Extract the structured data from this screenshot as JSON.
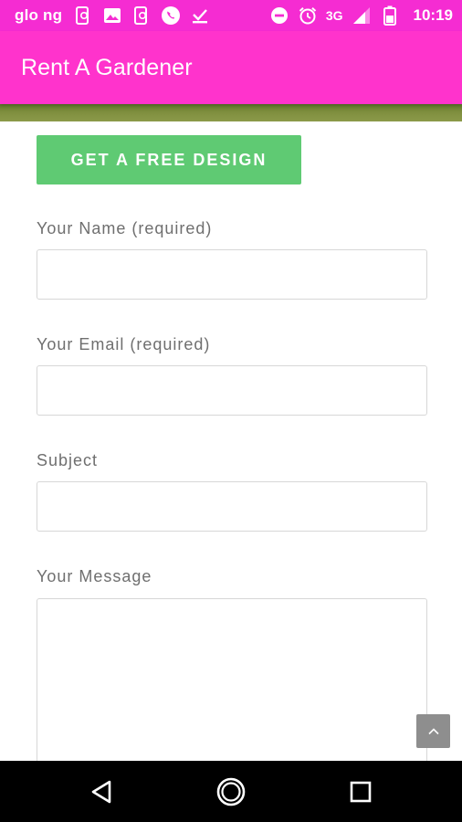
{
  "status_bar": {
    "carrier": "glo ng",
    "network_type": "3G",
    "time": "10:19",
    "icons_left": [
      "phone-sync-icon",
      "image-icon",
      "phone-sync-icon",
      "whatsapp-icon",
      "download-done-icon"
    ],
    "icons_right": [
      "do-not-disturb-icon",
      "alarm-icon",
      "signal-icon",
      "battery-icon"
    ]
  },
  "app_bar": {
    "title": "Rent A Gardener",
    "color": "#ff33cc"
  },
  "form": {
    "cta_label": "GET A FREE DESIGN",
    "cta_color": "#5fca73",
    "fields": [
      {
        "label": "Your Name (required)",
        "value": "",
        "placeholder": ""
      },
      {
        "label": "Your Email (required)",
        "value": "",
        "placeholder": ""
      },
      {
        "label": "Subject",
        "value": "",
        "placeholder": ""
      },
      {
        "label": "Your Message",
        "value": "",
        "placeholder": ""
      }
    ]
  },
  "scroll_top": {
    "icon": "chevron-up-icon"
  },
  "nav_bar": {
    "buttons": [
      "back-icon",
      "home-icon",
      "recents-icon"
    ]
  }
}
